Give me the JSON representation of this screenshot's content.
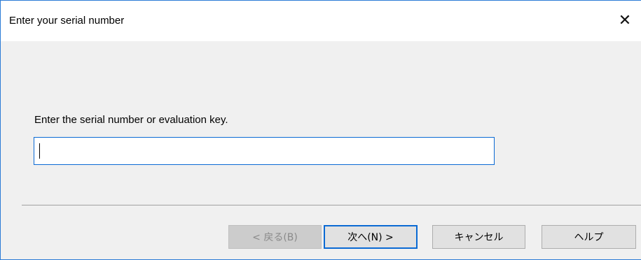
{
  "window": {
    "title": "Enter your serial number",
    "close_glyph": "✕",
    "close_icon": "close-icon"
  },
  "form": {
    "prompt": "Enter the serial number or evaluation key.",
    "serial_value": "",
    "serial_placeholder": ""
  },
  "buttons": {
    "back": "< 戻る(B)",
    "next": "次へ(N) >",
    "cancel": "キャンセル",
    "help": "ヘルプ"
  },
  "colors": {
    "accent": "#0a6ad4",
    "dialog_bg": "#f0f0f0",
    "button_bg": "#e1e1e1"
  }
}
